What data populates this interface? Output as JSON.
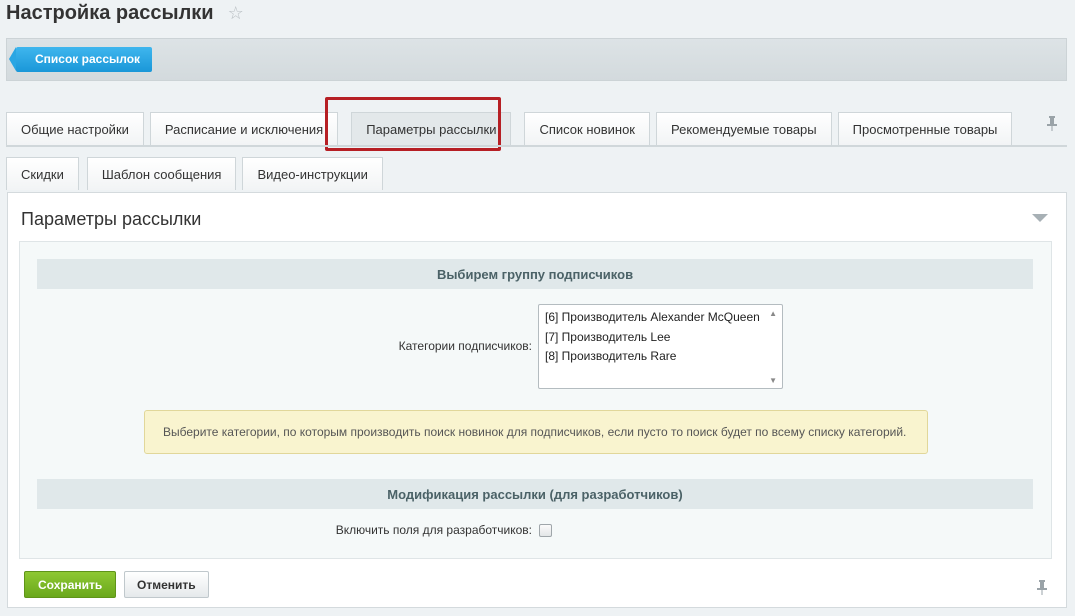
{
  "page": {
    "title": "Настройка рассылки"
  },
  "toolbar": {
    "back_label": "Список рассылок"
  },
  "tabs_primary": [
    {
      "label": "Общие настройки"
    },
    {
      "label": "Расписание и исключения"
    },
    {
      "label": "Параметры рассылки"
    },
    {
      "label": "Список новинок"
    },
    {
      "label": "Рекомендуемые товары"
    },
    {
      "label": "Просмотренные товары"
    }
  ],
  "tabs_secondary": [
    {
      "label": "Скидки"
    },
    {
      "label": "Шаблон сообщения"
    },
    {
      "label": "Видео-инструкции"
    }
  ],
  "active_tab": "Параметры рассылки",
  "panel": {
    "title": "Параметры рассылки",
    "section_subscribers": {
      "header": "Выбирем группу подписчиков",
      "categories_label": "Категории подписчиков:",
      "categories_options": [
        "[6] Производитель Alexander McQueen",
        "[7] Производитель Lee",
        "[8] Производитель Rare"
      ],
      "hint": "Выберите категории, по которым производить поиск новинок для подписчиков, если пусто то поиск будет по всему списку категорий."
    },
    "section_dev": {
      "header": "Модификация рассылки (для разработчиков)",
      "dev_fields_label": "Включить поля для разработчиков:",
      "dev_fields_checked": false
    }
  },
  "actions": {
    "save_label": "Сохранить",
    "cancel_label": "Отменить"
  },
  "colors": {
    "accent_blue": "#1a97d8",
    "save_green": "#6aa81c",
    "highlight_red": "#b61f24",
    "hint_bg": "#f9f4cf"
  }
}
